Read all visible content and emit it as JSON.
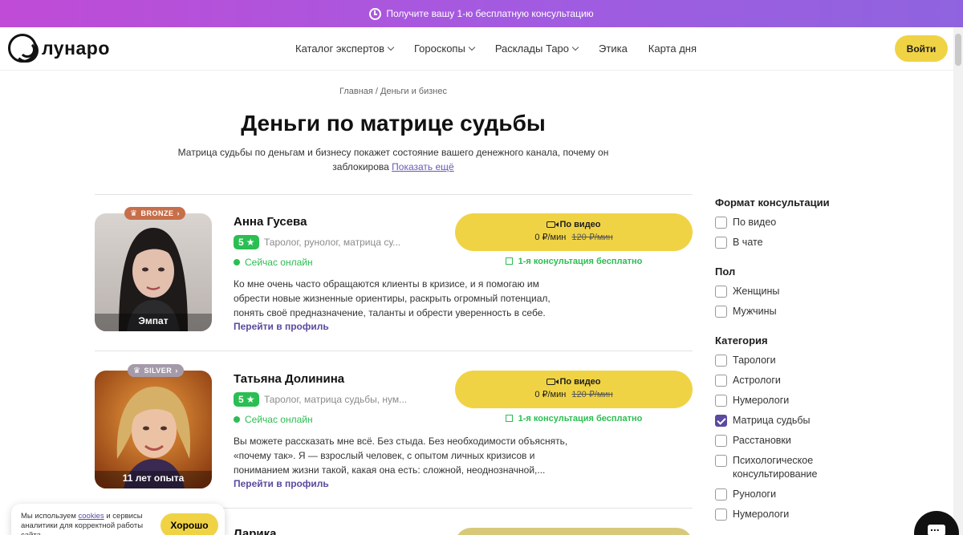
{
  "promo": {
    "text": "Получите вашу 1-ю бесплатную консультацию"
  },
  "header": {
    "logo": "лунаро",
    "nav": [
      {
        "label": "Каталог экспертов",
        "has_dropdown": true
      },
      {
        "label": "Гороскопы",
        "has_dropdown": true
      },
      {
        "label": "Расклады Таро",
        "has_dropdown": true
      },
      {
        "label": "Этика",
        "has_dropdown": false
      },
      {
        "label": "Карта дня",
        "has_dropdown": false
      }
    ],
    "login": "Войти"
  },
  "breadcrumb": "Главная / Деньги и бизнес",
  "page": {
    "title": "Деньги по матрице судьбы",
    "lead_line1": "Матрица судьбы по деньгам и бизнесу покажет состояние вашего денежного канала, почему он",
    "lead_line2": "заблокирова",
    "lead_more": "Показать ещё"
  },
  "experts": [
    {
      "badge": "BRONZE",
      "photo_label": "Эмпат",
      "name": "Анна Гусева",
      "rating": "5",
      "specs": "Таролог, рунолог, матрица су...",
      "online": "Сейчас онлайн",
      "desc": "Ко мне очень часто обращаются клиенты в кризисе, и я помогаю им обрести новые жизненные ориентиры, раскрыть огромный потенциал, понять своё предназначение, таланты и обрести уверенность в себе.",
      "profile_link": "Перейти в профиль",
      "cta_title": "По видео",
      "price": "0 ₽/мин",
      "old_price": "120 ₽/мин",
      "free": "1-я консультация бесплатно"
    },
    {
      "badge": "SILVER",
      "photo_label": "11 лет опыта",
      "name": "Татьяна Долинина",
      "rating": "5",
      "specs": "Таролог, матрица судьбы, нум...",
      "online": "Сейчас онлайн",
      "desc": "Вы можете рассказать мне всё. Без стыда. Без необходимости объяснять, «почему так». Я — взрослый человек, с опытом личных кризисов и пониманием жизни такой, какая она есть: сложной, неоднозначной,...",
      "profile_link": "Перейти в профиль",
      "cta_title": "По видео",
      "price": "0 ₽/мин",
      "old_price": "120 ₽/мин",
      "free": "1-я консультация бесплатно"
    }
  ],
  "next_expert_name": "Ларика",
  "filters": {
    "format": {
      "title": "Формат консультации",
      "items": [
        "По видео",
        "В чате"
      ]
    },
    "gender": {
      "title": "Пол",
      "items": [
        "Женщины",
        "Мужчины"
      ]
    },
    "category": {
      "title": "Категория",
      "items": [
        "Тарологи",
        "Астрологи",
        "Нумерологи",
        "Матрица судьбы",
        "Расстановки",
        "Психологическое консультирование",
        "Рунологи",
        "Нумерологи"
      ],
      "checked": "Матрица судьбы"
    }
  },
  "cookie": {
    "text_before": "Мы используем",
    "link": "cookies",
    "text_after": "и сервисы аналитики для корректной работы сайта",
    "button": "Хорошо"
  },
  "colors": {
    "accent_yellow": "#f0d345",
    "online_green": "#2bbe52",
    "brand_purple": "#5b4a9e"
  }
}
